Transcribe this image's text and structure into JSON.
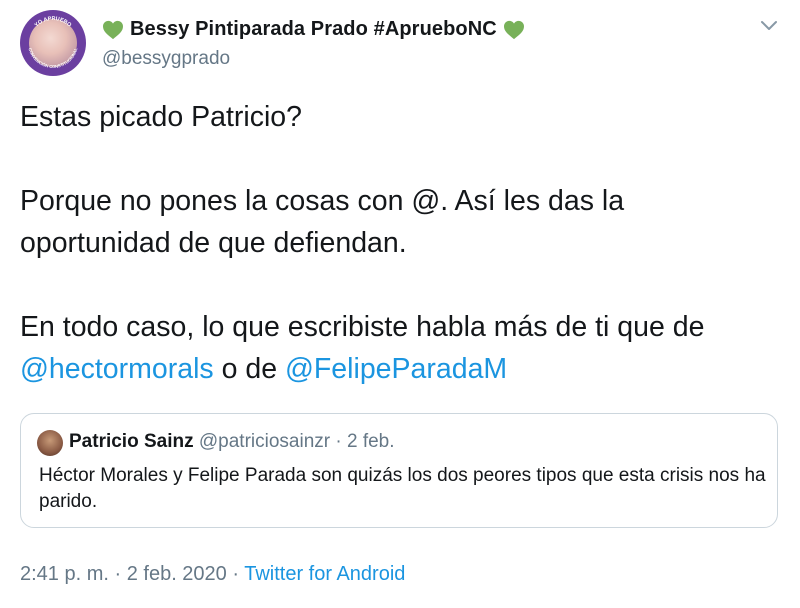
{
  "tweet": {
    "display_name": "Bessy Pintiparada Prado #AprueboNC",
    "handle": "@bessygprado",
    "avatar_badge_top": "YO APRUEBO",
    "avatar_badge_bottom": "CONVENCIÓN CONSTITUCIONAL",
    "body": {
      "line1": "Estas picado Patricio?",
      "line2": "Porque no pones la cosas con @. Así les das la",
      "line3": "oportunidad de que defiendan.",
      "line4": "En todo caso, lo que escribiste habla más de ti que de",
      "mention1": "@hectormorals",
      "connector": " o de ",
      "mention2": "@FelipeParadaM"
    },
    "timestamp": "2:41 p. m. · 2 feb. 2020 · ",
    "source": "Twitter for Android"
  },
  "quoted": {
    "name": "Patricio Sainz",
    "meta": " @patriciosainzr · 2 feb.",
    "text": "Héctor Morales y Felipe Parada son quizás los dos peores tipos que esta crisis nos ha parido."
  },
  "icons": {
    "heart": "green-heart-icon",
    "menu": "chevron-down-icon"
  },
  "colors": {
    "heart": "#78b159",
    "link": "#1b95e0",
    "secondary": "#657786"
  }
}
